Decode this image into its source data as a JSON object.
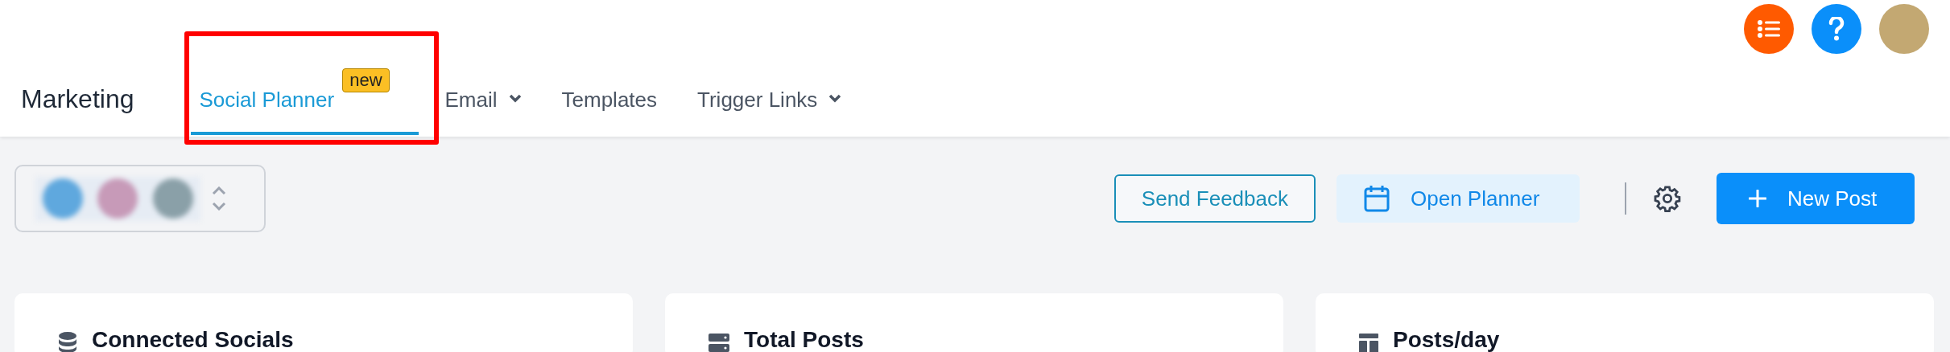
{
  "header": {
    "title": "Marketing",
    "tabs": [
      {
        "label": "Social Planner",
        "selected": true,
        "badge": "new",
        "dropdown": false,
        "highlighted": true
      },
      {
        "label": "Email",
        "selected": false,
        "dropdown": true,
        "highlighted": false
      },
      {
        "label": "Templates",
        "selected": false,
        "dropdown": false,
        "highlighted": false
      },
      {
        "label": "Trigger Links",
        "selected": false,
        "dropdown": true,
        "highlighted": false
      }
    ]
  },
  "toolbar": {
    "buttons": [
      {
        "label": "Send Feedback",
        "kind": "outline"
      },
      {
        "label": "Open Planner",
        "kind": "soft"
      },
      {
        "label": "New Post",
        "kind": "primary"
      }
    ]
  },
  "cards": [
    {
      "title": "Connected Socials",
      "kind": "database"
    },
    {
      "title": "Total Posts",
      "kind": "server"
    },
    {
      "title": "Posts/day",
      "kind": "layout"
    }
  ]
}
